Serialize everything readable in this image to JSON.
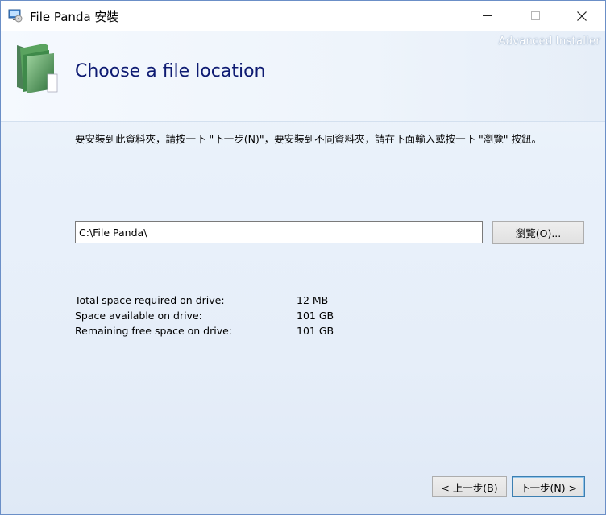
{
  "window": {
    "title": "File Panda 安裝",
    "controls": {
      "minimize": "minimize-icon",
      "maximize": "maximize-icon",
      "close": "close-icon"
    }
  },
  "header": {
    "brand": "Advanced Installer",
    "title": "Choose a file location",
    "icon": "folder-icon"
  },
  "main": {
    "instructions": "要安裝到此資料夾，請按一下 \"下一步(N)\"，要安裝到不同資料夾，請在下面輸入或按一下 \"瀏覽\" 按鈕。",
    "install_path": "C:\\File Panda\\",
    "browse_label": "瀏覽(O)...",
    "space": [
      {
        "label": "Total space required on drive:",
        "value": "12 MB"
      },
      {
        "label": "Space available on drive:",
        "value": "101 GB"
      },
      {
        "label": "Remaining free space on drive:",
        "value": "101 GB"
      }
    ]
  },
  "footer": {
    "back_label": "< 上一步(B)",
    "next_label": "下一步(N) >"
  },
  "colors": {
    "title": "#0e1b72",
    "background": "#e9f1fa",
    "button_border": "#adadad",
    "default_button_border": "#3c7fb1"
  }
}
